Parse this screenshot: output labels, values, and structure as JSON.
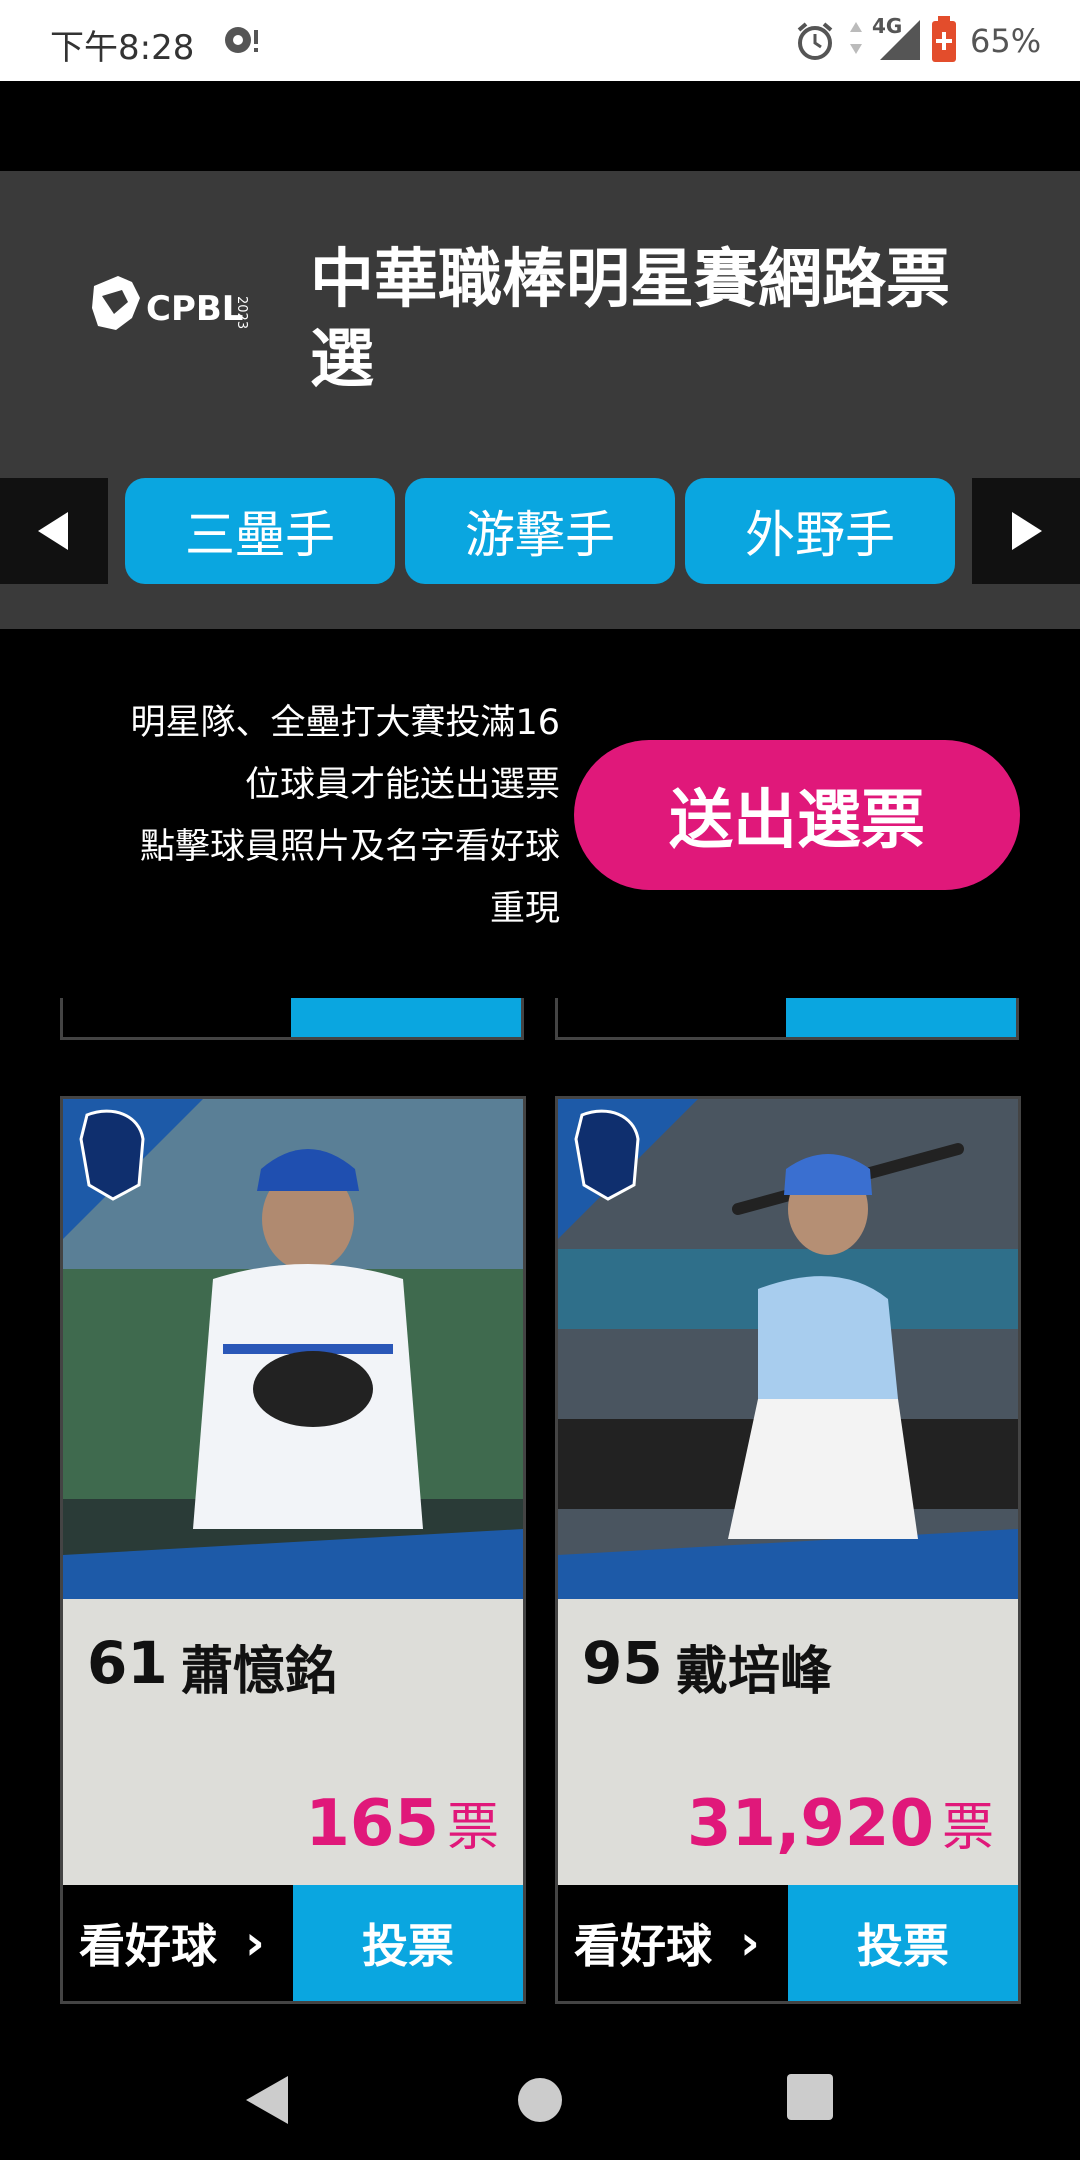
{
  "status_bar": {
    "time": "下午8:28",
    "network": "4G",
    "battery": "65%"
  },
  "header": {
    "logo_text": "CPBL",
    "logo_year": "2023",
    "title": "中華職棒明星賽網路票選"
  },
  "position_tabs": [
    {
      "label": "三壘手"
    },
    {
      "label": "游擊手"
    },
    {
      "label": "外野手"
    }
  ],
  "notice": {
    "line1": "明星隊、全壘打大賽投滿16",
    "line2": "位球員才能送出選票",
    "line3": "點擊球員照片及名字看好球",
    "line4": "重現"
  },
  "submit_button": "送出選票",
  "players": [
    {
      "number": "61",
      "name": "蕭憶銘",
      "votes": "165",
      "vote_unit": "票",
      "replay_label": "看好球",
      "vote_label": "投票",
      "team": "Guardians"
    },
    {
      "number": "95",
      "name": "戴培峰",
      "votes": "31,920",
      "vote_unit": "票",
      "replay_label": "看好球",
      "vote_label": "投票",
      "team": "Guardians"
    }
  ],
  "colors": {
    "accent_blue": "#0aa6e0",
    "accent_pink": "#e0187a",
    "header_bg": "#3a3a3a"
  }
}
